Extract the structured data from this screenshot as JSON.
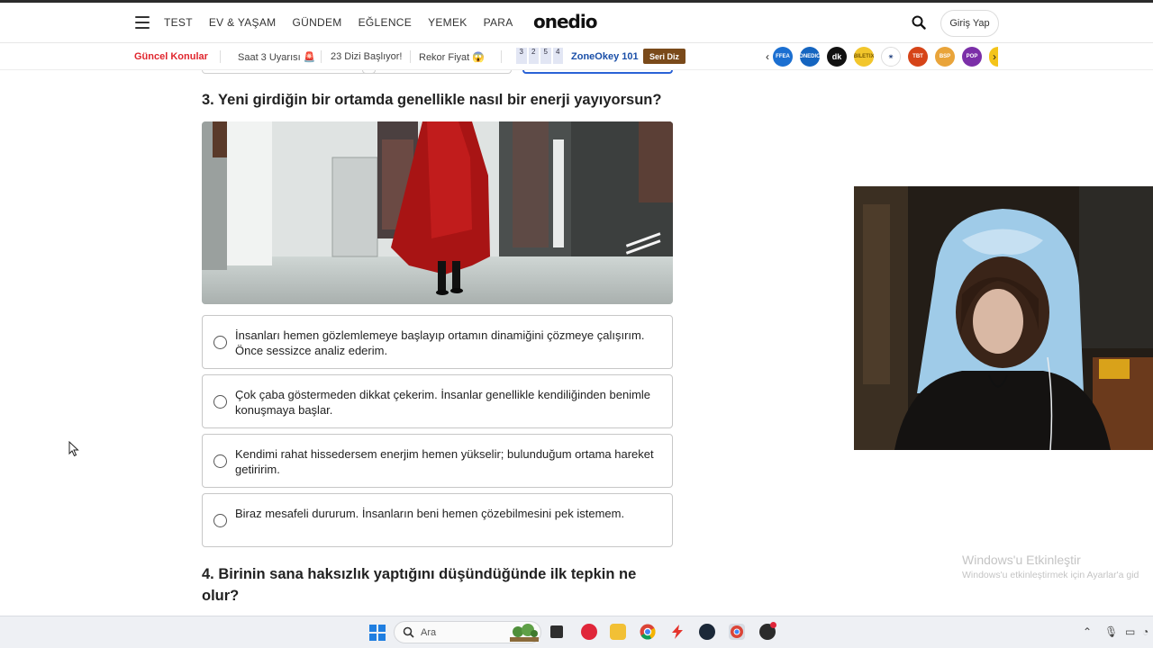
{
  "header": {
    "nav": [
      "TEST",
      "EV & YAŞAM",
      "GÜNDEM",
      "EĞLENCE",
      "YEMEK",
      "PARA"
    ],
    "logo": "onedio",
    "login": "Giriş Yap"
  },
  "subnav": {
    "guncel": "Güncel Konular",
    "topics": [
      "Saat 3 Uyarısı 🚨",
      "23 Dizi Başlıyor!",
      "Rekor Fiyat 😱"
    ],
    "scores": [
      "3",
      "2",
      "5",
      "4"
    ],
    "zone": "ZoneOkey 101",
    "seri": "Seri Diz",
    "brands": [
      "FFEA",
      "ONEDIO",
      "dk",
      "BILETIX",
      "TBT",
      "BSP",
      "POP"
    ]
  },
  "quiz": {
    "q3": "3. Yeni girdiğin bir ortamda genellikle nasıl bir enerji yayıyorsun?",
    "options": [
      "İnsanları hemen gözlemlemeye başlayıp ortamın dinamiğini çözmeye çalışırım. Önce sessizce analiz ederim.",
      "Çok çaba göstermeden dikkat çekerim. İnsanlar genellikle kendiliğinden benimle konuşmaya başlar.",
      "Kendimi rahat hissedersem enerjim hemen yükselir; bulunduğum ortama hareket getiririm.",
      "Biraz mesafeli dururum. İnsanların beni hemen çözebilmesini pek istemem."
    ],
    "q4": "4. Birinin sana haksızlık yaptığını düşündüğünde ilk tepkin ne olur?"
  },
  "windows": {
    "activate_title": "Windows'u Etkinleştir",
    "activate_sub": "Windows'u etkinleştirmek için Ayarlar'a gid"
  },
  "taskbar": {
    "search": "Ara",
    "apps": [
      "files-icon",
      "opera-icon",
      "folder-icon",
      "chrome-icon",
      "bolt-icon",
      "steam-icon",
      "chrome-beta-icon",
      "obs-icon"
    ]
  }
}
